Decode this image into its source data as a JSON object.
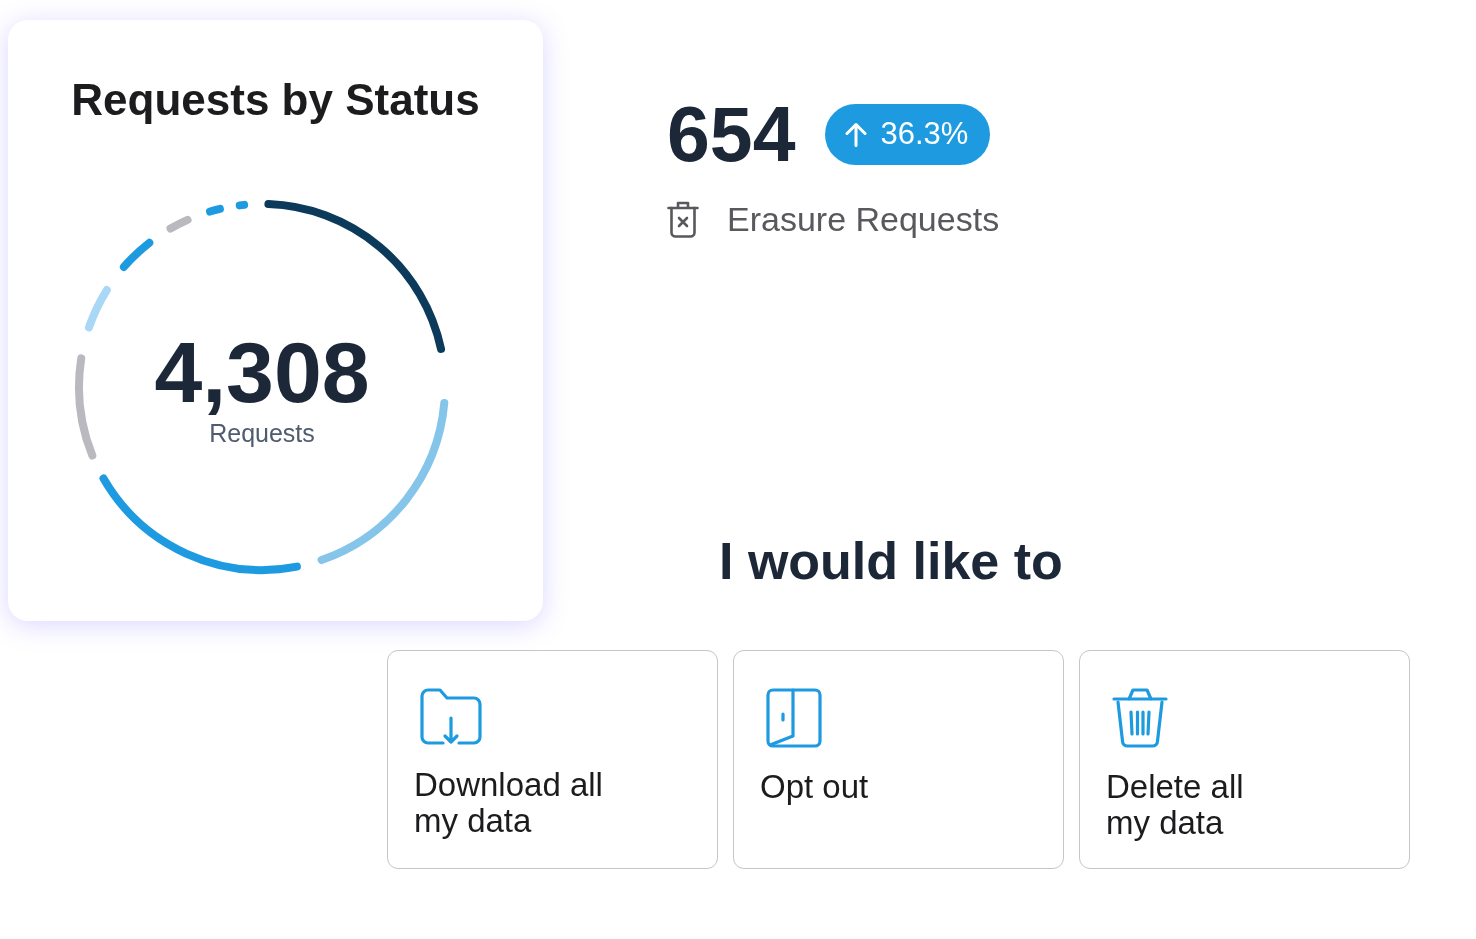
{
  "status_card": {
    "title": "Requests by Status",
    "total": "4,308",
    "total_label": "Requests"
  },
  "stat": {
    "value": "654",
    "increase": true,
    "change": "36.3%",
    "label": "Erasure Requests"
  },
  "actions": {
    "heading": "I would like to",
    "buttons": [
      {
        "kind": "download",
        "lines": [
          "Download all",
          "my data"
        ]
      },
      {
        "kind": "opt_out",
        "lines": [
          "Opt out"
        ]
      },
      {
        "kind": "delete",
        "lines": [
          "Delete all",
          "my data"
        ]
      }
    ]
  }
}
